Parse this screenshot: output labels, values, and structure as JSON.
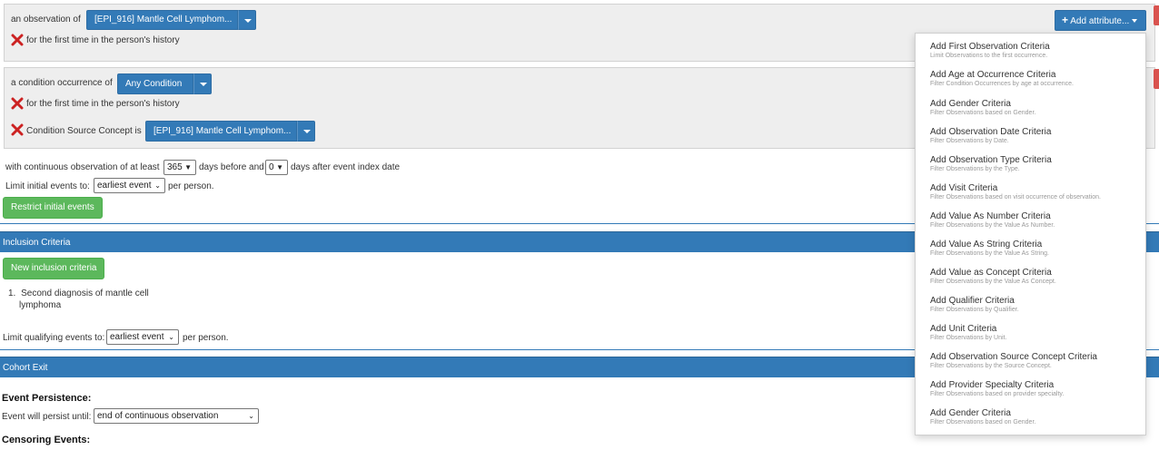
{
  "observation_block": {
    "lead_text": "an observation of",
    "concept_button": "[EPI_916] Mantle Cell Lymphom...",
    "first_time_text": "for the first time in the person's history",
    "add_attribute_button": "Add attribute..."
  },
  "condition_block": {
    "lead_text": "a condition occurrence of",
    "concept_button": "Any Condition",
    "first_time_text": "for the first time in the person's history",
    "source_concept_text": "Condition Source Concept is",
    "source_concept_button": "[EPI_916] Mantle Cell Lymphom..."
  },
  "observation_window": {
    "prefix": "with continuous observation of at least",
    "before_value": "365",
    "middle": "days before and",
    "after_value": "0",
    "suffix": "days after event index date"
  },
  "limit_initial": {
    "label": "Limit initial events to:",
    "value": "earliest event",
    "suffix": "per person."
  },
  "restrict_button": "Restrict initial events",
  "inclusion": {
    "header": "Inclusion Criteria",
    "new_button": "New inclusion criteria",
    "items": [
      {
        "number": "1.",
        "line1": "Second diagnosis of mantle cell",
        "line2": "lymphoma"
      }
    ]
  },
  "limit_qualifying": {
    "label": "Limit qualifying events to:",
    "value": "earliest event",
    "suffix": "per person."
  },
  "cohort_exit": {
    "header": "Cohort Exit",
    "persistence_heading": "Event Persistence:",
    "persist_label": "Event will persist until:",
    "persist_value": "end of continuous observation",
    "censoring_heading": "Censoring Events:"
  },
  "attribute_menu": [
    {
      "title": "Add First Observation Criteria",
      "desc": "Limit Observations to the first occurrence."
    },
    {
      "title": "Add Age at Occurrence Criteria",
      "desc": "Filter Condition Occurrences by age at occurrence."
    },
    {
      "title": "Add Gender Criteria",
      "desc": "Filter Observations based on Gender."
    },
    {
      "title": "Add Observation Date Criteria",
      "desc": "Filter Observations by Date."
    },
    {
      "title": "Add Observation Type Criteria",
      "desc": "Filter Observations by the Type."
    },
    {
      "title": "Add Visit Criteria",
      "desc": "Filter Observations based on visit occurrence of observation."
    },
    {
      "title": "Add Value As Number Criteria",
      "desc": "Filter Observations by the Value As Number."
    },
    {
      "title": "Add Value As String Criteria",
      "desc": "Filter Observations by the Value As String."
    },
    {
      "title": "Add Value as Concept Criteria",
      "desc": "Filter Observations by the Value As Concept."
    },
    {
      "title": "Add Qualifier Criteria",
      "desc": "Filter Observations by Qualifier."
    },
    {
      "title": "Add Unit Criteria",
      "desc": "Filter Observations by Unit."
    },
    {
      "title": "Add Observation Source Concept Criteria",
      "desc": "Filter Observations by the Source Concept."
    },
    {
      "title": "Add Provider Specialty Criteria",
      "desc": "Filter Observations based on provider specialty."
    },
    {
      "title": "Add Gender Criteria",
      "desc": "Filter Observations based on Gender."
    }
  ],
  "colors": {
    "primary": "#337ab7",
    "success": "#5cb85c",
    "danger": "#d9534f",
    "remove_icon": "#cc2222",
    "panel_bg": "#eeeeee"
  },
  "icons": {
    "remove": "x-icon",
    "plus": "plus-icon",
    "dropdown": "caret-down-icon"
  }
}
